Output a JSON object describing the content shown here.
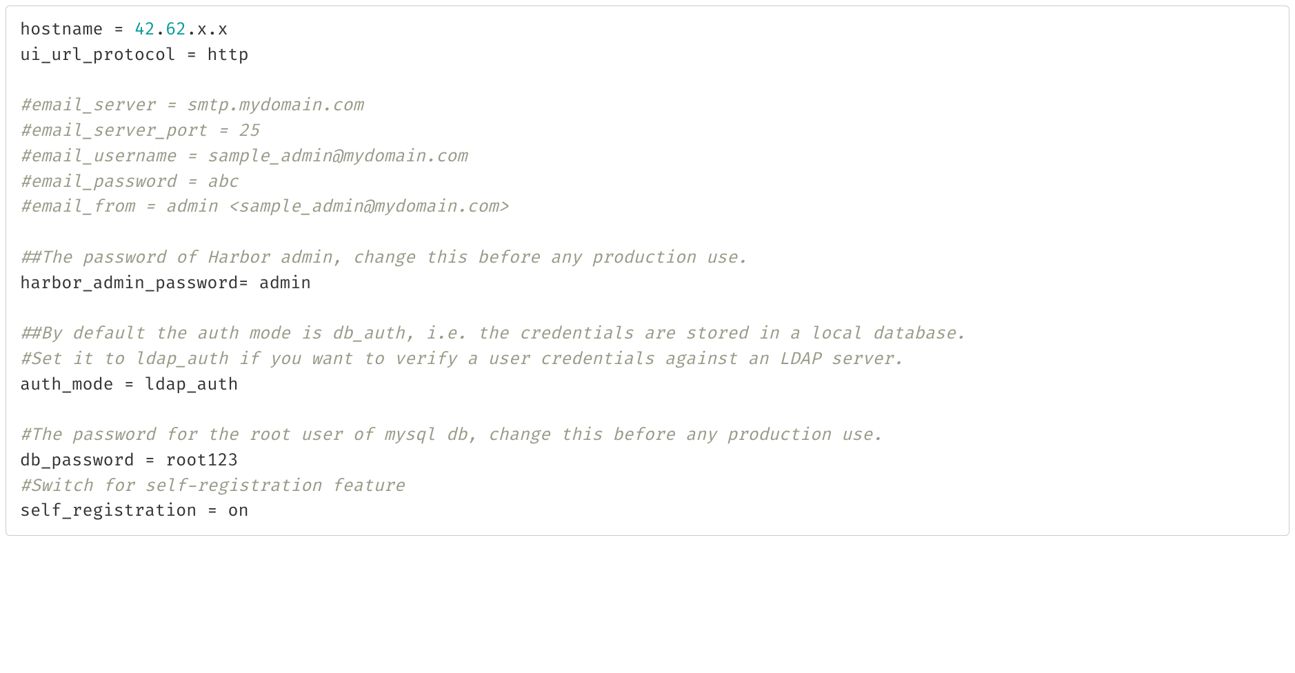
{
  "code": {
    "line1_a": "hostname = ",
    "line1_num1": "42",
    "line1_dot1": ".",
    "line1_num2": "62",
    "line1_b": ".x.x",
    "line2": "ui_url_protocol = http",
    "line3": "",
    "line4": "#email_server = smtp.mydomain.com",
    "line5": "#email_server_port = 25",
    "line6": "#email_username = sample_admin@mydomain.com",
    "line7": "#email_password = abc",
    "line8": "#email_from = admin <sample_admin@mydomain.com>",
    "line9": "",
    "line10": "##The password of Harbor admin, change this before any production use.",
    "line11": "harbor_admin_password= admin",
    "line12": "",
    "line13": "##By default the auth mode is db_auth, i.e. the credentials are stored in a local database.",
    "line14": "#Set it to ldap_auth if you want to verify a user credentials against an LDAP server.",
    "line15": "auth_mode = ldap_auth",
    "line16": "",
    "line17": "#The password for the root user of mysql db, change this before any production use.",
    "line18": "db_password = root123",
    "line19": "#Switch for self-registration feature",
    "line20": "self_registration = on"
  }
}
